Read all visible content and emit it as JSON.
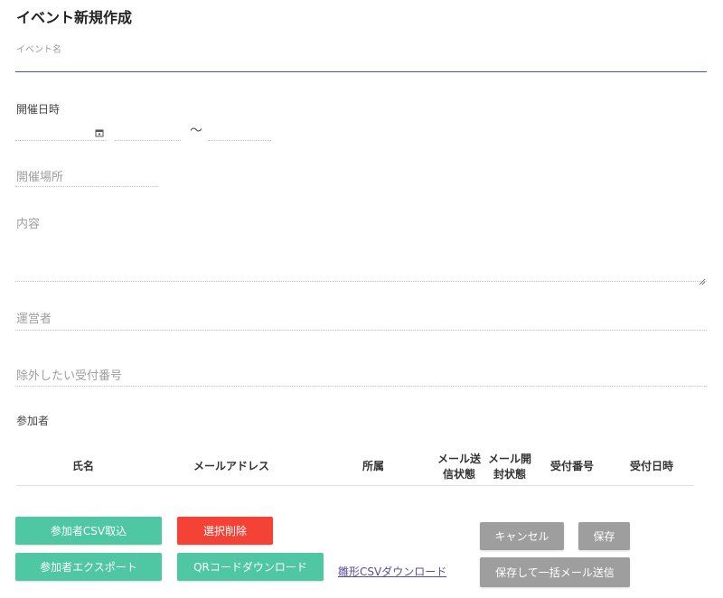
{
  "page": {
    "title": "イベント新規作成"
  },
  "form": {
    "event_name_label": "イベント名",
    "date_label": "開催日時",
    "date_separator": "～",
    "venue_placeholder": "開催場所",
    "content_placeholder": "内容",
    "organizer_placeholder": "運営者",
    "excluded_placeholder": "除外したい受付番号",
    "participants_label": "参加者"
  },
  "table": {
    "columns": [
      {
        "label": "氏名"
      },
      {
        "label": "メールアドレス"
      },
      {
        "label": "所属"
      },
      {
        "label_line1": "メール送",
        "label_line2": "信状態"
      },
      {
        "label_line1": "メール開",
        "label_line2": "封状態"
      },
      {
        "label": "受付番号"
      },
      {
        "label": "受付日時"
      }
    ]
  },
  "buttons": {
    "import_csv": "参加者CSV取込",
    "delete_selected": "選択削除",
    "export": "参加者エクスポート",
    "qr_download": "QRコードダウンロード",
    "template_csv_link": "雛形CSVダウンロード",
    "cancel": "キャンセル",
    "save": "保存",
    "save_and_send": "保存して一括メール送信"
  },
  "colors": {
    "accent_underline": "#3f51b5",
    "green_button": "#4fc7a3",
    "red_button": "#f44336",
    "grey_button": "#9e9e9e",
    "link": "#5b4b9b"
  },
  "icons": {
    "date_picker": "calendar-icon",
    "textarea_resize": "resize-handle-icon"
  }
}
